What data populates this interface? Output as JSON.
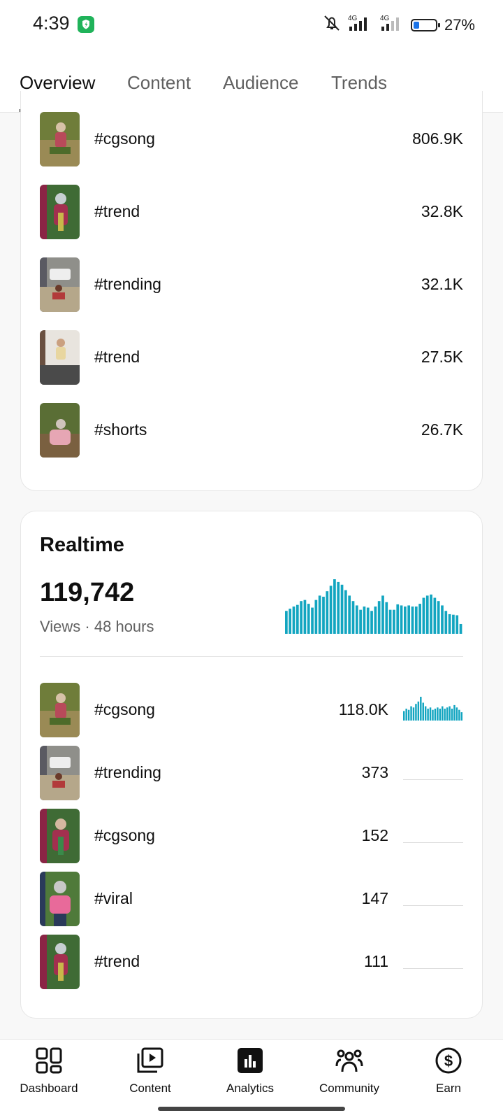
{
  "status_bar": {
    "time": "4:39",
    "battery": "27%",
    "network_1": "4G",
    "network_2": "4G"
  },
  "tabs": [
    {
      "label": "Overview",
      "active": true
    },
    {
      "label": "Content",
      "active": false
    },
    {
      "label": "Audience",
      "active": false
    },
    {
      "label": "Trends",
      "active": false
    }
  ],
  "top_content": {
    "items": [
      {
        "title": "#cgsong",
        "value": "806.9K"
      },
      {
        "title": "#trend",
        "value": "32.8K"
      },
      {
        "title": "#trending",
        "value": "32.1K"
      },
      {
        "title": "#trend",
        "value": "27.5K"
      },
      {
        "title": "#shorts",
        "value": "26.7K"
      }
    ]
  },
  "realtime": {
    "title": "Realtime",
    "views": "119,742",
    "views_label": "Views",
    "separator": "·",
    "period": "48 hours",
    "hourly_views_relative": [
      0.42,
      0.46,
      0.5,
      0.53,
      0.6,
      0.62,
      0.55,
      0.48,
      0.62,
      0.7,
      0.68,
      0.78,
      0.88,
      1.0,
      0.95,
      0.9,
      0.8,
      0.7,
      0.6,
      0.52,
      0.44,
      0.5,
      0.48,
      0.42,
      0.5,
      0.6,
      0.7,
      0.58,
      0.44,
      0.44,
      0.54,
      0.52,
      0.5,
      0.52,
      0.5,
      0.5,
      0.55,
      0.66,
      0.7,
      0.72,
      0.66,
      0.6,
      0.52,
      0.42,
      0.36,
      0.35,
      0.34,
      0.18
    ],
    "items": [
      {
        "title": "#cgsong",
        "value": "118.0K",
        "trend": [
          0.4,
          0.5,
          0.45,
          0.6,
          0.55,
          0.7,
          0.8,
          1.0,
          0.75,
          0.6,
          0.5,
          0.55,
          0.45,
          0.5,
          0.55,
          0.5,
          0.6,
          0.5,
          0.55,
          0.6,
          0.5,
          0.65,
          0.55,
          0.45,
          0.35
        ],
        "active": true
      },
      {
        "title": "#trending",
        "value": "373",
        "active": false
      },
      {
        "title": "#cgsong",
        "value": "152",
        "active": false
      },
      {
        "title": "#viral",
        "value": "147",
        "active": false
      },
      {
        "title": "#trend",
        "value": "111",
        "active": false
      }
    ]
  },
  "accent_color": "#12a5c0",
  "bottom_nav": [
    {
      "label": "Dashboard",
      "icon": "dashboard-icon"
    },
    {
      "label": "Content",
      "icon": "content-icon"
    },
    {
      "label": "Analytics",
      "icon": "analytics-icon",
      "active": true
    },
    {
      "label": "Community",
      "icon": "community-icon"
    },
    {
      "label": "Earn",
      "icon": "earn-icon"
    }
  ]
}
